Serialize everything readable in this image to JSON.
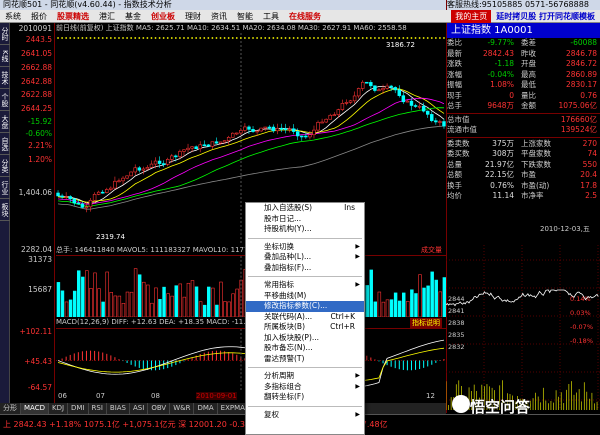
{
  "window": {
    "title": "同花顺501 - 同花顺(v4.60.44) - 指数技术分析",
    "right_title": "客服热线:95105885 0571-56768888"
  },
  "menu": {
    "items": [
      "系统",
      "报价",
      "股票精选",
      "港汇",
      "基金",
      "创业板",
      "理财",
      "资讯",
      "智能",
      "工具",
      "在线服务"
    ],
    "highlight": [
      "股票精选",
      "创业板",
      "在线服务"
    ],
    "brand": "我的主页",
    "promo": "延时拷贝股 打开同花顺模板"
  },
  "left_tabs": [
    "分时",
    "K线",
    "技术",
    "个股",
    "大盘",
    "自选",
    "分类",
    "行业",
    "板块"
  ],
  "scale": {
    "price": [
      "2010091",
      "2443.5",
      "2641.05",
      "2662.88",
      "2642.88",
      "2622.88",
      "2644.25",
      "-15.92",
      "-0.60%",
      "2.21%",
      "1.20%",
      "1,404.06"
    ],
    "vol": [
      "2282.04",
      "31373",
      "15687"
    ],
    "macd": [
      "+102.11",
      "+45.43",
      "-64.57"
    ]
  },
  "chart": {
    "head": "前日线(前复权)  上证指数  MA5: 2625.71  MA10: 2634.51  MA20: 2634.08  MA30: 2627.91  MA60: 2558.58",
    "high_label": "3186.72",
    "low_label": "2319.74",
    "vol_head": "总手: 146411840   MAVOL5: 111183327   MAVOL10: 117700",
    "vol_tag": "成交量",
    "macd_head": "MACD(12,26,9)  DIFF: +12.63  DEA: +18.35  MACD: -11.44",
    "macd_tag": "指标说明",
    "dates": [
      "06",
      "07",
      "08",
      "09",
      "10",
      "11",
      "12"
    ],
    "date_marker": "2010-09-01",
    "colors": {
      "up": "#ff3333",
      "down": "#00ffff",
      "ma5": "#ffffff",
      "ma10": "#ffff00",
      "ma20": "#ff00ff",
      "ma30": "#00ff00",
      "ma60": "#888888"
    }
  },
  "tabs": [
    "分形",
    "MACD",
    "KDJ",
    "DMI",
    "RSI",
    "BIAS",
    "ASI",
    "OBV",
    "W&R",
    "DMA",
    "EXPMA",
    "资金",
    "更多"
  ],
  "status": "上 2842.43   +1.18%   1075.1亿   +1,075.1亿元   深 12001.20   -0.30%   100.5亿   +56.12   -0.23%   67.48亿",
  "right": {
    "title": "上证指数  1A0001",
    "badge": "我的主页",
    "rows": [
      {
        "k": "委比",
        "v": "-9.77%",
        "k2": "委差",
        "v2": "-60088"
      },
      {
        "k": "最新",
        "v": "2842.43",
        "k2": "昨收",
        "v2": "2846.78"
      },
      {
        "k": "涨跌",
        "v": "-1.18",
        "k2": "开盘",
        "v2": "2846.72"
      },
      {
        "k": "涨幅",
        "v": "-0.04%",
        "k2": "最高",
        "v2": "2860.89"
      },
      {
        "k": "振幅",
        "v": "1.08%",
        "k2": "最低",
        "v2": "2830.17"
      },
      {
        "k": "现手",
        "v": "0",
        "k2": "量比",
        "v2": "0.76"
      },
      {
        "k": "总手",
        "v": "9648万",
        "k2": "金额",
        "v2": "1075.06亿"
      }
    ],
    "rows2": [
      {
        "k": "总市值",
        "v2": "176660亿"
      },
      {
        "k": "流通市值",
        "v2": "139524亿"
      }
    ],
    "rows3": [
      {
        "k": "委卖数",
        "v": "375万",
        "k2": "上涨家数",
        "v2": "270"
      },
      {
        "k": "委买数",
        "v": "308万",
        "k2": "平盘家数",
        "v2": "74"
      },
      {
        "k": "总量",
        "v": "21.97亿",
        "k2": "下跌家数",
        "v2": "550"
      },
      {
        "k": "总额",
        "v": "22.15亿",
        "k2": "市盈",
        "v2": "20.4"
      },
      {
        "k": "换手",
        "v": "0.76%",
        "k2": "市盈(动)",
        "v2": "17.8"
      },
      {
        "k": "均价",
        "v": "11.14",
        "k2": "市净率",
        "v2": "2.5"
      }
    ],
    "mini_date": "2010-12-03,五",
    "mini_axis_left": [
      "2844",
      "2841",
      "2838",
      "2835",
      "2832"
    ],
    "mini_axis_right": [
      "0.14%",
      "0.03%",
      "-0.07%",
      "-0.18%"
    ]
  },
  "context_menu": {
    "groups": [
      [
        {
          "label": "加入自选股(S)",
          "shortcut": "Ins"
        },
        {
          "label": "股市日记..."
        },
        {
          "label": "持股机构(Y)..."
        }
      ],
      [
        {
          "label": "坐标切换",
          "arrow": true
        },
        {
          "label": "叠加品种(L)...",
          "arrow": true
        },
        {
          "label": "叠加指标(F)..."
        }
      ],
      [
        {
          "label": "常用指标",
          "arrow": true
        },
        {
          "label": "平移曲线(M)"
        },
        {
          "label": "修改指标参数(C)...",
          "selected": true
        },
        {
          "label": "关联代码(A)...",
          "shortcut": "Ctrl+K"
        },
        {
          "label": "所属板块(B)",
          "shortcut": "Ctrl+R"
        },
        {
          "label": "加入板块股(P)..."
        },
        {
          "label": "股市备忘(N)..."
        },
        {
          "label": "雷达预警(T)"
        }
      ],
      [
        {
          "label": "分析周期",
          "arrow": true
        },
        {
          "label": "多指标组合",
          "arrow": true
        },
        {
          "label": "翻转坐标(F)"
        }
      ],
      [
        {
          "label": "复权",
          "arrow": true
        }
      ]
    ]
  },
  "watermark": "悟空问答"
}
